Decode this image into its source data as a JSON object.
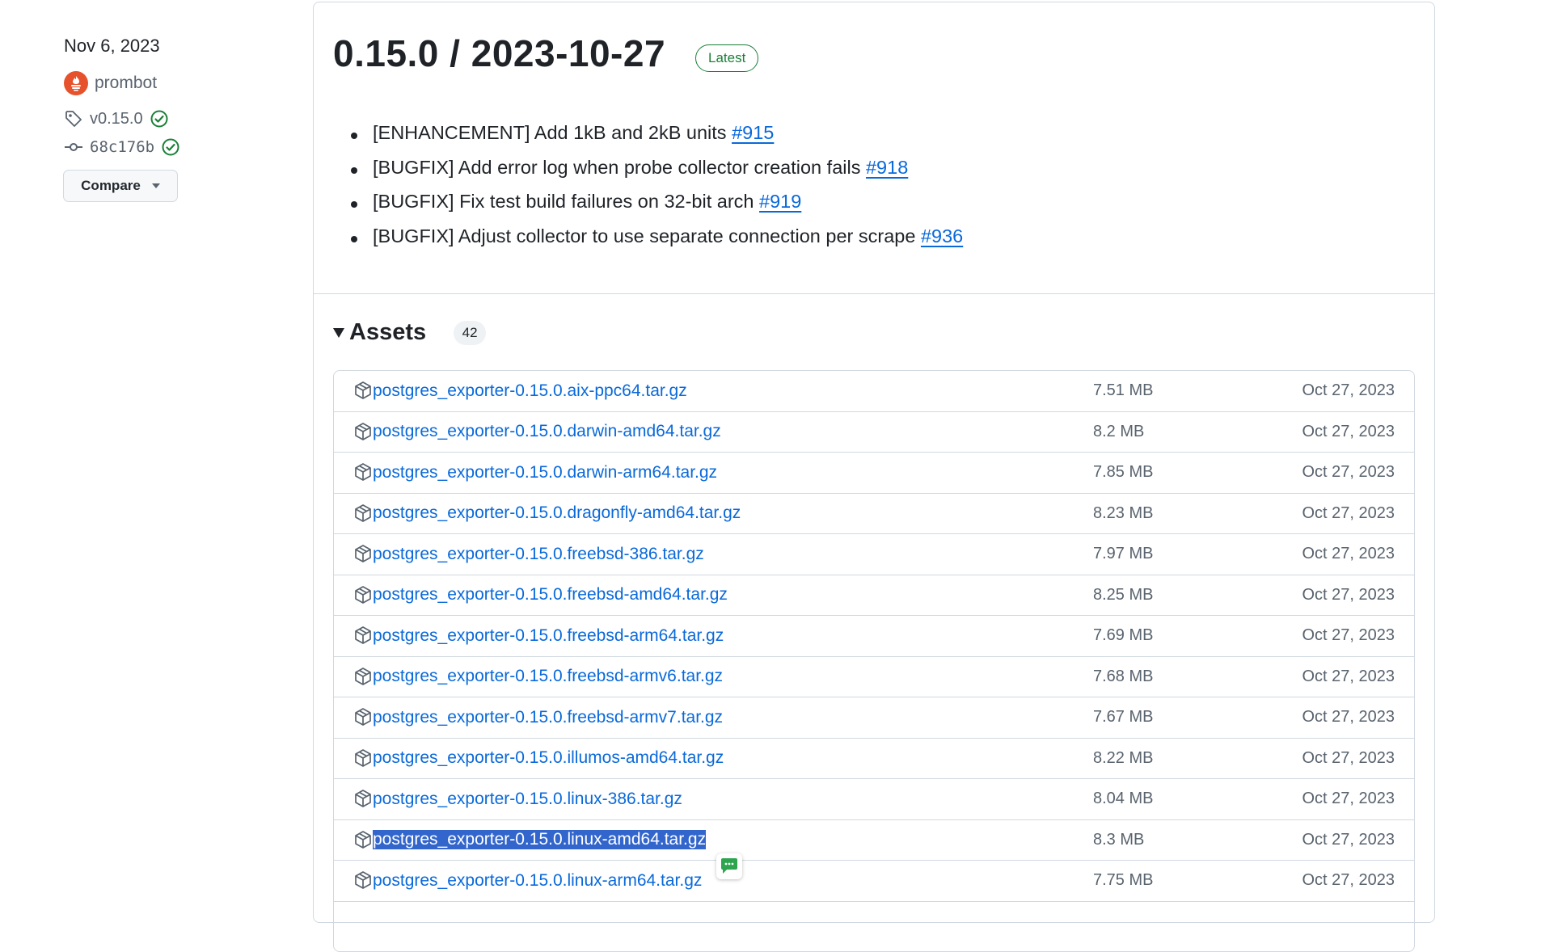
{
  "sidebar": {
    "date": "Nov 6, 2023",
    "author": "prombot",
    "tag": "v0.15.0",
    "commit": "68c176b",
    "compare_label": "Compare"
  },
  "release": {
    "title": "0.15.0 / 2023-10-27",
    "badge": "Latest",
    "notes": [
      {
        "text": "[ENHANCEMENT] Add 1kB and 2kB units ",
        "link": "#915"
      },
      {
        "text": "[BUGFIX] Add error log when probe collector creation fails ",
        "link": "#918"
      },
      {
        "text": "[BUGFIX] Fix test build failures on 32-bit arch ",
        "link": "#919"
      },
      {
        "text": "[BUGFIX] Adjust collector to use separate connection per scrape ",
        "link": "#936"
      }
    ]
  },
  "assets": {
    "label": "Assets",
    "count": "42",
    "items": [
      {
        "name": "postgres_exporter-0.15.0.aix-ppc64.tar.gz",
        "size": "7.51 MB",
        "date": "Oct 27, 2023"
      },
      {
        "name": "postgres_exporter-0.15.0.darwin-amd64.tar.gz",
        "size": "8.2 MB",
        "date": "Oct 27, 2023"
      },
      {
        "name": "postgres_exporter-0.15.0.darwin-arm64.tar.gz",
        "size": "7.85 MB",
        "date": "Oct 27, 2023"
      },
      {
        "name": "postgres_exporter-0.15.0.dragonfly-amd64.tar.gz",
        "size": "8.23 MB",
        "date": "Oct 27, 2023"
      },
      {
        "name": "postgres_exporter-0.15.0.freebsd-386.tar.gz",
        "size": "7.97 MB",
        "date": "Oct 27, 2023"
      },
      {
        "name": "postgres_exporter-0.15.0.freebsd-amd64.tar.gz",
        "size": "8.25 MB",
        "date": "Oct 27, 2023"
      },
      {
        "name": "postgres_exporter-0.15.0.freebsd-arm64.tar.gz",
        "size": "7.69 MB",
        "date": "Oct 27, 2023"
      },
      {
        "name": "postgres_exporter-0.15.0.freebsd-armv6.tar.gz",
        "size": "7.68 MB",
        "date": "Oct 27, 2023"
      },
      {
        "name": "postgres_exporter-0.15.0.freebsd-armv7.tar.gz",
        "size": "7.67 MB",
        "date": "Oct 27, 2023"
      },
      {
        "name": "postgres_exporter-0.15.0.illumos-amd64.tar.gz",
        "size": "8.22 MB",
        "date": "Oct 27, 2023"
      },
      {
        "name": "postgres_exporter-0.15.0.linux-386.tar.gz",
        "size": "8.04 MB",
        "date": "Oct 27, 2023"
      },
      {
        "name": "postgres_exporter-0.15.0.linux-amd64.tar.gz",
        "size": "8.3 MB",
        "date": "Oct 27, 2023",
        "selected": true
      },
      {
        "name": "postgres_exporter-0.15.0.linux-arm64.tar.gz",
        "size": "7.75 MB",
        "date": "Oct 27, 2023"
      }
    ]
  },
  "colors": {
    "link": "#0969da",
    "latest_green": "#1a7f37",
    "selection": "#3366cc",
    "border": "#d1d9e0",
    "muted": "#59636e"
  }
}
